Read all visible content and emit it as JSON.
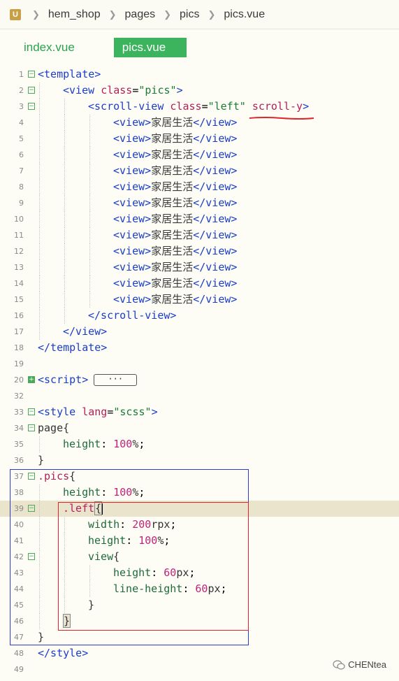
{
  "breadcrumb": {
    "items": [
      "hem_shop",
      "pages",
      "pics",
      "pics.vue"
    ]
  },
  "tabs": [
    {
      "label": "index.vue",
      "active": false
    },
    {
      "label": "pics.vue",
      "active": true
    }
  ],
  "code": {
    "lines": [
      {
        "n": "1",
        "fold": "minus",
        "indent": 0,
        "html": "<span class=\"t-tag\">&lt;template&gt;</span>"
      },
      {
        "n": "2",
        "fold": "minus",
        "indent": 1,
        "html": "<span class=\"t-tag\">&lt;view</span> <span class=\"t-attr\">class</span>=<span class=\"t-str\">\"pics\"</span><span class=\"t-tag\">&gt;</span>"
      },
      {
        "n": "3",
        "fold": "minus",
        "indent": 2,
        "html": "<span class=\"t-tag\">&lt;scroll-view</span> <span class=\"t-attr\">class</span>=<span class=\"t-str\">\"left\"</span> <span class=\"t-attr\">scroll-y</span><span class=\"t-tag\">&gt;</span>"
      },
      {
        "n": "4",
        "fold": "",
        "indent": 3,
        "html": "<span class=\"t-tag\">&lt;view&gt;</span><span class=\"t-text\">家居生活</span><span class=\"t-tag\">&lt;/view&gt;</span>"
      },
      {
        "n": "5",
        "fold": "",
        "indent": 3,
        "html": "<span class=\"t-tag\">&lt;view&gt;</span><span class=\"t-text\">家居生活</span><span class=\"t-tag\">&lt;/view&gt;</span>"
      },
      {
        "n": "6",
        "fold": "",
        "indent": 3,
        "html": "<span class=\"t-tag\">&lt;view&gt;</span><span class=\"t-text\">家居生活</span><span class=\"t-tag\">&lt;/view&gt;</span>"
      },
      {
        "n": "7",
        "fold": "",
        "indent": 3,
        "html": "<span class=\"t-tag\">&lt;view&gt;</span><span class=\"t-text\">家居生活</span><span class=\"t-tag\">&lt;/view&gt;</span>"
      },
      {
        "n": "8",
        "fold": "",
        "indent": 3,
        "html": "<span class=\"t-tag\">&lt;view&gt;</span><span class=\"t-text\">家居生活</span><span class=\"t-tag\">&lt;/view&gt;</span>"
      },
      {
        "n": "9",
        "fold": "",
        "indent": 3,
        "html": "<span class=\"t-tag\">&lt;view&gt;</span><span class=\"t-text\">家居生活</span><span class=\"t-tag\">&lt;/view&gt;</span>"
      },
      {
        "n": "10",
        "fold": "",
        "indent": 3,
        "html": "<span class=\"t-tag\">&lt;view&gt;</span><span class=\"t-text\">家居生活</span><span class=\"t-tag\">&lt;/view&gt;</span>"
      },
      {
        "n": "11",
        "fold": "",
        "indent": 3,
        "html": "<span class=\"t-tag\">&lt;view&gt;</span><span class=\"t-text\">家居生活</span><span class=\"t-tag\">&lt;/view&gt;</span>"
      },
      {
        "n": "12",
        "fold": "",
        "indent": 3,
        "html": "<span class=\"t-tag\">&lt;view&gt;</span><span class=\"t-text\">家居生活</span><span class=\"t-tag\">&lt;/view&gt;</span>"
      },
      {
        "n": "13",
        "fold": "",
        "indent": 3,
        "html": "<span class=\"t-tag\">&lt;view&gt;</span><span class=\"t-text\">家居生活</span><span class=\"t-tag\">&lt;/view&gt;</span>"
      },
      {
        "n": "14",
        "fold": "",
        "indent": 3,
        "html": "<span class=\"t-tag\">&lt;view&gt;</span><span class=\"t-text\">家居生活</span><span class=\"t-tag\">&lt;/view&gt;</span>"
      },
      {
        "n": "15",
        "fold": "",
        "indent": 3,
        "html": "<span class=\"t-tag\">&lt;view&gt;</span><span class=\"t-text\">家居生活</span><span class=\"t-tag\">&lt;/view&gt;</span>"
      },
      {
        "n": "16",
        "fold": "",
        "indent": 2,
        "html": "<span class=\"t-tag\">&lt;/scroll-view&gt;</span>"
      },
      {
        "n": "17",
        "fold": "",
        "indent": 1,
        "html": "<span class=\"t-tag\">&lt;/view&gt;</span>"
      },
      {
        "n": "18",
        "fold": "",
        "indent": 0,
        "html": "<span class=\"t-tag\">&lt;/template&gt;</span>"
      },
      {
        "n": "19",
        "fold": "",
        "indent": 0,
        "html": ""
      },
      {
        "n": "20",
        "fold": "plus",
        "indent": 0,
        "html": "<span class=\"t-tag\">&lt;script&gt;</span><span class=\"collapsed\">···</span>"
      },
      {
        "n": "32",
        "fold": "",
        "indent": 0,
        "html": ""
      },
      {
        "n": "33",
        "fold": "minus",
        "indent": 0,
        "html": "<span class=\"t-tag\">&lt;style</span> <span class=\"t-attr\">lang</span>=<span class=\"t-str\">\"scss\"</span><span class=\"t-tag\">&gt;</span>"
      },
      {
        "n": "34",
        "fold": "minus",
        "indent": 0,
        "html": "<span class=\"t-brace\">page{</span>"
      },
      {
        "n": "35",
        "fold": "",
        "indent": 1,
        "html": "<span class=\"t-prop\">height</span>: <span class=\"t-num\">100</span><span class=\"t-unit\">%</span>;"
      },
      {
        "n": "36",
        "fold": "",
        "indent": 0,
        "html": "<span class=\"t-brace\">}</span>"
      },
      {
        "n": "37",
        "fold": "minus",
        "indent": 0,
        "html": "<span class=\"t-sel\">.pics</span><span class=\"t-brace\">{</span>"
      },
      {
        "n": "38",
        "fold": "",
        "indent": 1,
        "html": "<span class=\"t-prop\">height</span>: <span class=\"t-num\">100</span><span class=\"t-unit\">%</span>;"
      },
      {
        "n": "39",
        "fold": "minus",
        "indent": 1,
        "hl": true,
        "html": "<span class=\"t-sel\">.left</span><span class=\"t-brace bracket-box\">{</span><span class=\"cursor\"></span>"
      },
      {
        "n": "40",
        "fold": "",
        "indent": 2,
        "html": "<span class=\"t-prop\">width</span>: <span class=\"t-num\">200</span><span class=\"t-unit\">rpx</span>;"
      },
      {
        "n": "41",
        "fold": "",
        "indent": 2,
        "html": "<span class=\"t-prop\">height</span>: <span class=\"t-num\">100</span><span class=\"t-unit\">%</span>;"
      },
      {
        "n": "42",
        "fold": "minus",
        "indent": 2,
        "html": "<span class=\"t-prop\">view</span><span class=\"t-brace\">{</span>"
      },
      {
        "n": "43",
        "fold": "",
        "indent": 3,
        "html": "<span class=\"t-prop\">height</span>: <span class=\"t-num\">60</span><span class=\"t-unit\">px</span>;"
      },
      {
        "n": "44",
        "fold": "",
        "indent": 3,
        "html": "<span class=\"t-prop\">line-height</span>: <span class=\"t-num\">60</span><span class=\"t-unit\">px</span>;"
      },
      {
        "n": "45",
        "fold": "",
        "indent": 2,
        "html": "<span class=\"t-brace\">}</span>"
      },
      {
        "n": "46",
        "fold": "",
        "indent": 1,
        "html": "<span class=\"t-brace bracket-box\">}</span>"
      },
      {
        "n": "47",
        "fold": "",
        "indent": 0,
        "html": "<span class=\"t-brace\">}</span>"
      },
      {
        "n": "48",
        "fold": "",
        "indent": 0,
        "html": "<span class=\"t-tag\">&lt;/style&gt;</span>"
      },
      {
        "n": "49",
        "fold": "",
        "indent": 0,
        "html": ""
      }
    ]
  },
  "watermark": {
    "label": "CHENtea"
  },
  "colors": {
    "tag": "#1a3dc8",
    "attr": "#b2205a",
    "string": "#1a7a36",
    "number": "#c0237a",
    "tab_active": "#3cb35d",
    "blue_box": "#2c3cc9",
    "red_box": "#e0242a"
  }
}
